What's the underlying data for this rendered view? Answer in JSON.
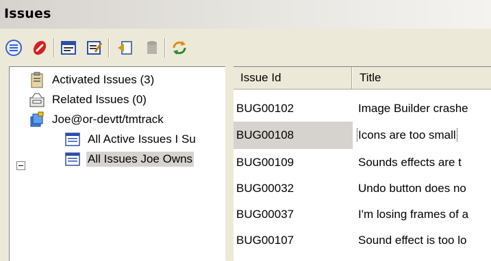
{
  "window": {
    "title": "Issues"
  },
  "toolbar": {
    "buttons": [
      {
        "icon": "list-view-icon"
      },
      {
        "icon": "bug-icon"
      },
      {
        "icon": "query-icon"
      },
      {
        "icon": "edit-icon"
      },
      {
        "icon": "import-icon"
      },
      {
        "icon": "disabled-database-icon"
      },
      {
        "icon": "refresh-icon"
      }
    ]
  },
  "tree": {
    "items": [
      {
        "label": "Activated Issues (3)",
        "icon": "clipboard-icon"
      },
      {
        "label": "Related Issues (0)",
        "icon": "inbox-icon"
      },
      {
        "label": "Joe@or-devtt/tmtrack",
        "icon": "database-icon"
      },
      {
        "label": "All Active Issues I Su",
        "icon": "query-list-icon"
      },
      {
        "label": "All Issues Joe Owns",
        "icon": "query-list-icon",
        "selected": true
      }
    ]
  },
  "list": {
    "columns": [
      "Issue Id",
      "Title"
    ],
    "rows": [
      {
        "id": "BUG00102",
        "title": "Image Builder crashe"
      },
      {
        "id": "BUG00108",
        "title": "Icons are too small",
        "selected": true
      },
      {
        "id": "BUG00109",
        "title": "Sounds effects are t"
      },
      {
        "id": "BUG00032",
        "title": "Undo button does no"
      },
      {
        "id": "BUG00037",
        "title": "I'm losing frames of a"
      },
      {
        "id": "BUG00107",
        "title": "Sound effect is too lo"
      }
    ]
  },
  "colors": {
    "chrome": "#ece9d8",
    "selection": "#d6d3ce",
    "border": "#808080"
  }
}
